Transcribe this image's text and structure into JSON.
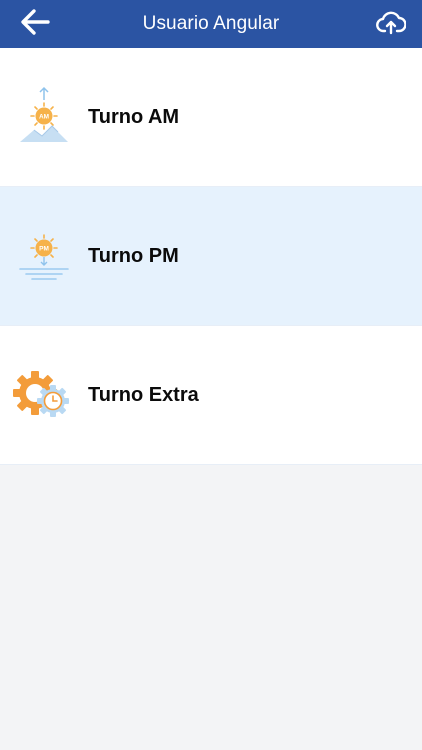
{
  "header": {
    "title": "Usuario Angular",
    "back_icon": "arrow-left-icon",
    "upload_icon": "cloud-upload-icon",
    "bar_color": "#2b54a3"
  },
  "shifts": [
    {
      "label": "Turno AM",
      "icon": "sunrise-am-icon"
    },
    {
      "label": "Turno PM",
      "icon": "sunset-pm-icon",
      "highlighted": true
    },
    {
      "label": "Turno Extra",
      "icon": "gear-clock-icon"
    }
  ],
  "colors": {
    "highlight_row": "#e6f2fd",
    "page_background": "#f3f4f6",
    "sun": "#f6b24a"
  }
}
